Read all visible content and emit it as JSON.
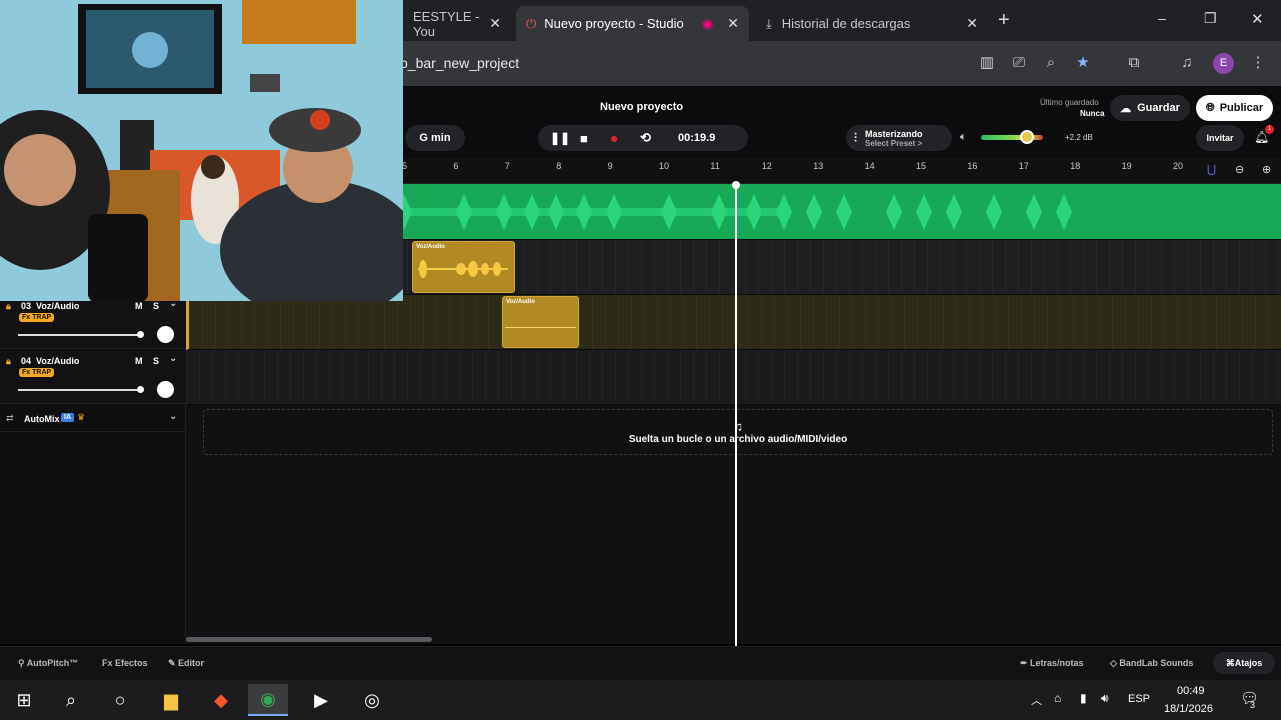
{
  "browser": {
    "tabs": [
      {
        "label": "EESTYLE - You",
        "active": false
      },
      {
        "label": "Nuevo proyecto - Studio",
        "active": true
      },
      {
        "label": "Historial de descargas",
        "active": false
      }
    ],
    "new_tab": "+",
    "url": "p_bar_new_project",
    "profile_initial": "E",
    "window_controls": {
      "min": "–",
      "max": "❐",
      "close": "✕"
    }
  },
  "studio": {
    "project_title": "Nuevo proyecto",
    "key_label": "G min",
    "time": "00:19.9",
    "mastering_label": "Masterizando",
    "mastering_preset": "Select Preset >",
    "volume_db": "+2.2 dB",
    "last_saved_label": "Último guardado",
    "last_saved_value": "Nunca",
    "save_label": "Guardar",
    "publish_label": "Publicar",
    "invite_label": "Invitar",
    "notification_count": "1",
    "ruler_ticks": [
      "5",
      "6",
      "7",
      "8",
      "9",
      "10",
      "11",
      "12",
      "13",
      "14",
      "15",
      "16",
      "17",
      "18",
      "19",
      "20"
    ],
    "tracks": [
      {
        "number": "03",
        "name": "Voz/Audio",
        "fx": "Fx TRAP",
        "m": "M",
        "s": "S"
      },
      {
        "number": "04",
        "name": "Voz/Audio",
        "fx": "Fx TRAP",
        "m": "M",
        "s": "S"
      }
    ],
    "clips": [
      {
        "label": "Voz/Audio"
      },
      {
        "label": "Voz/Audio"
      }
    ],
    "automix_label": "AutoMix",
    "automix_badge": "IA",
    "drop_text": "Suelta un bucle o un archivo audio/MIDI/video",
    "bottom": {
      "autopitch": "AutoPitch™",
      "effects": "Efectos",
      "editor": "Editor",
      "lyrics": "Letras/notas",
      "sounds": "BandLab Sounds",
      "shortcuts": "Atajos"
    }
  },
  "taskbar": {
    "lang": "ESP",
    "time": "00:49",
    "date": "18/1/2026",
    "notif_count": "3"
  },
  "colors": {
    "waveform_green": "#1fbf66",
    "clip_gold": "#b08a25",
    "accent_orange": "#f7a823",
    "record_red": "#e5202e"
  }
}
